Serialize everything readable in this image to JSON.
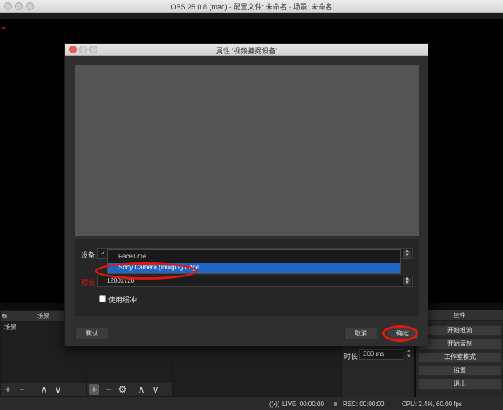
{
  "window": {
    "title": "OBS 25.0.8 (mac) - 配置文件: 未命名 - 场景: 未命名"
  },
  "dialog": {
    "title": "属性 '视频捕捉设备'",
    "device_label": "设备",
    "device_value": "✓",
    "device_options": [
      {
        "label": "FaceTime",
        "selected": false
      },
      {
        "label": "Sony Camera (Imaging Edge",
        "selected": true
      }
    ],
    "preset_label": "预设",
    "preset_value": "1280x720",
    "use_buffer_label": "使用缓冲",
    "use_buffer_checked": false,
    "defaults_button": "默认",
    "cancel_button": "取消",
    "ok_button": "确定",
    "highlight_color": "#e3180c",
    "selection_color": "#2166c4"
  },
  "docks": {
    "scenes": {
      "header": "场景",
      "items": [
        "场景"
      ]
    },
    "controls": {
      "header": "控件",
      "buttons": [
        "开始推流",
        "开始录制",
        "工作室模式",
        "设置",
        "退出"
      ]
    },
    "transition": {
      "duration_label": "时长",
      "duration_value": "300 ms"
    }
  },
  "toolbar_icons": {
    "add": "+",
    "remove": "−",
    "up": "∧",
    "down": "∨",
    "gear": "⚙"
  },
  "status": {
    "live": "LIVE: 00:00:00",
    "rec": "REC: 00:00:00",
    "cpu": "CPU: 2.4%, 60.00 fps"
  }
}
